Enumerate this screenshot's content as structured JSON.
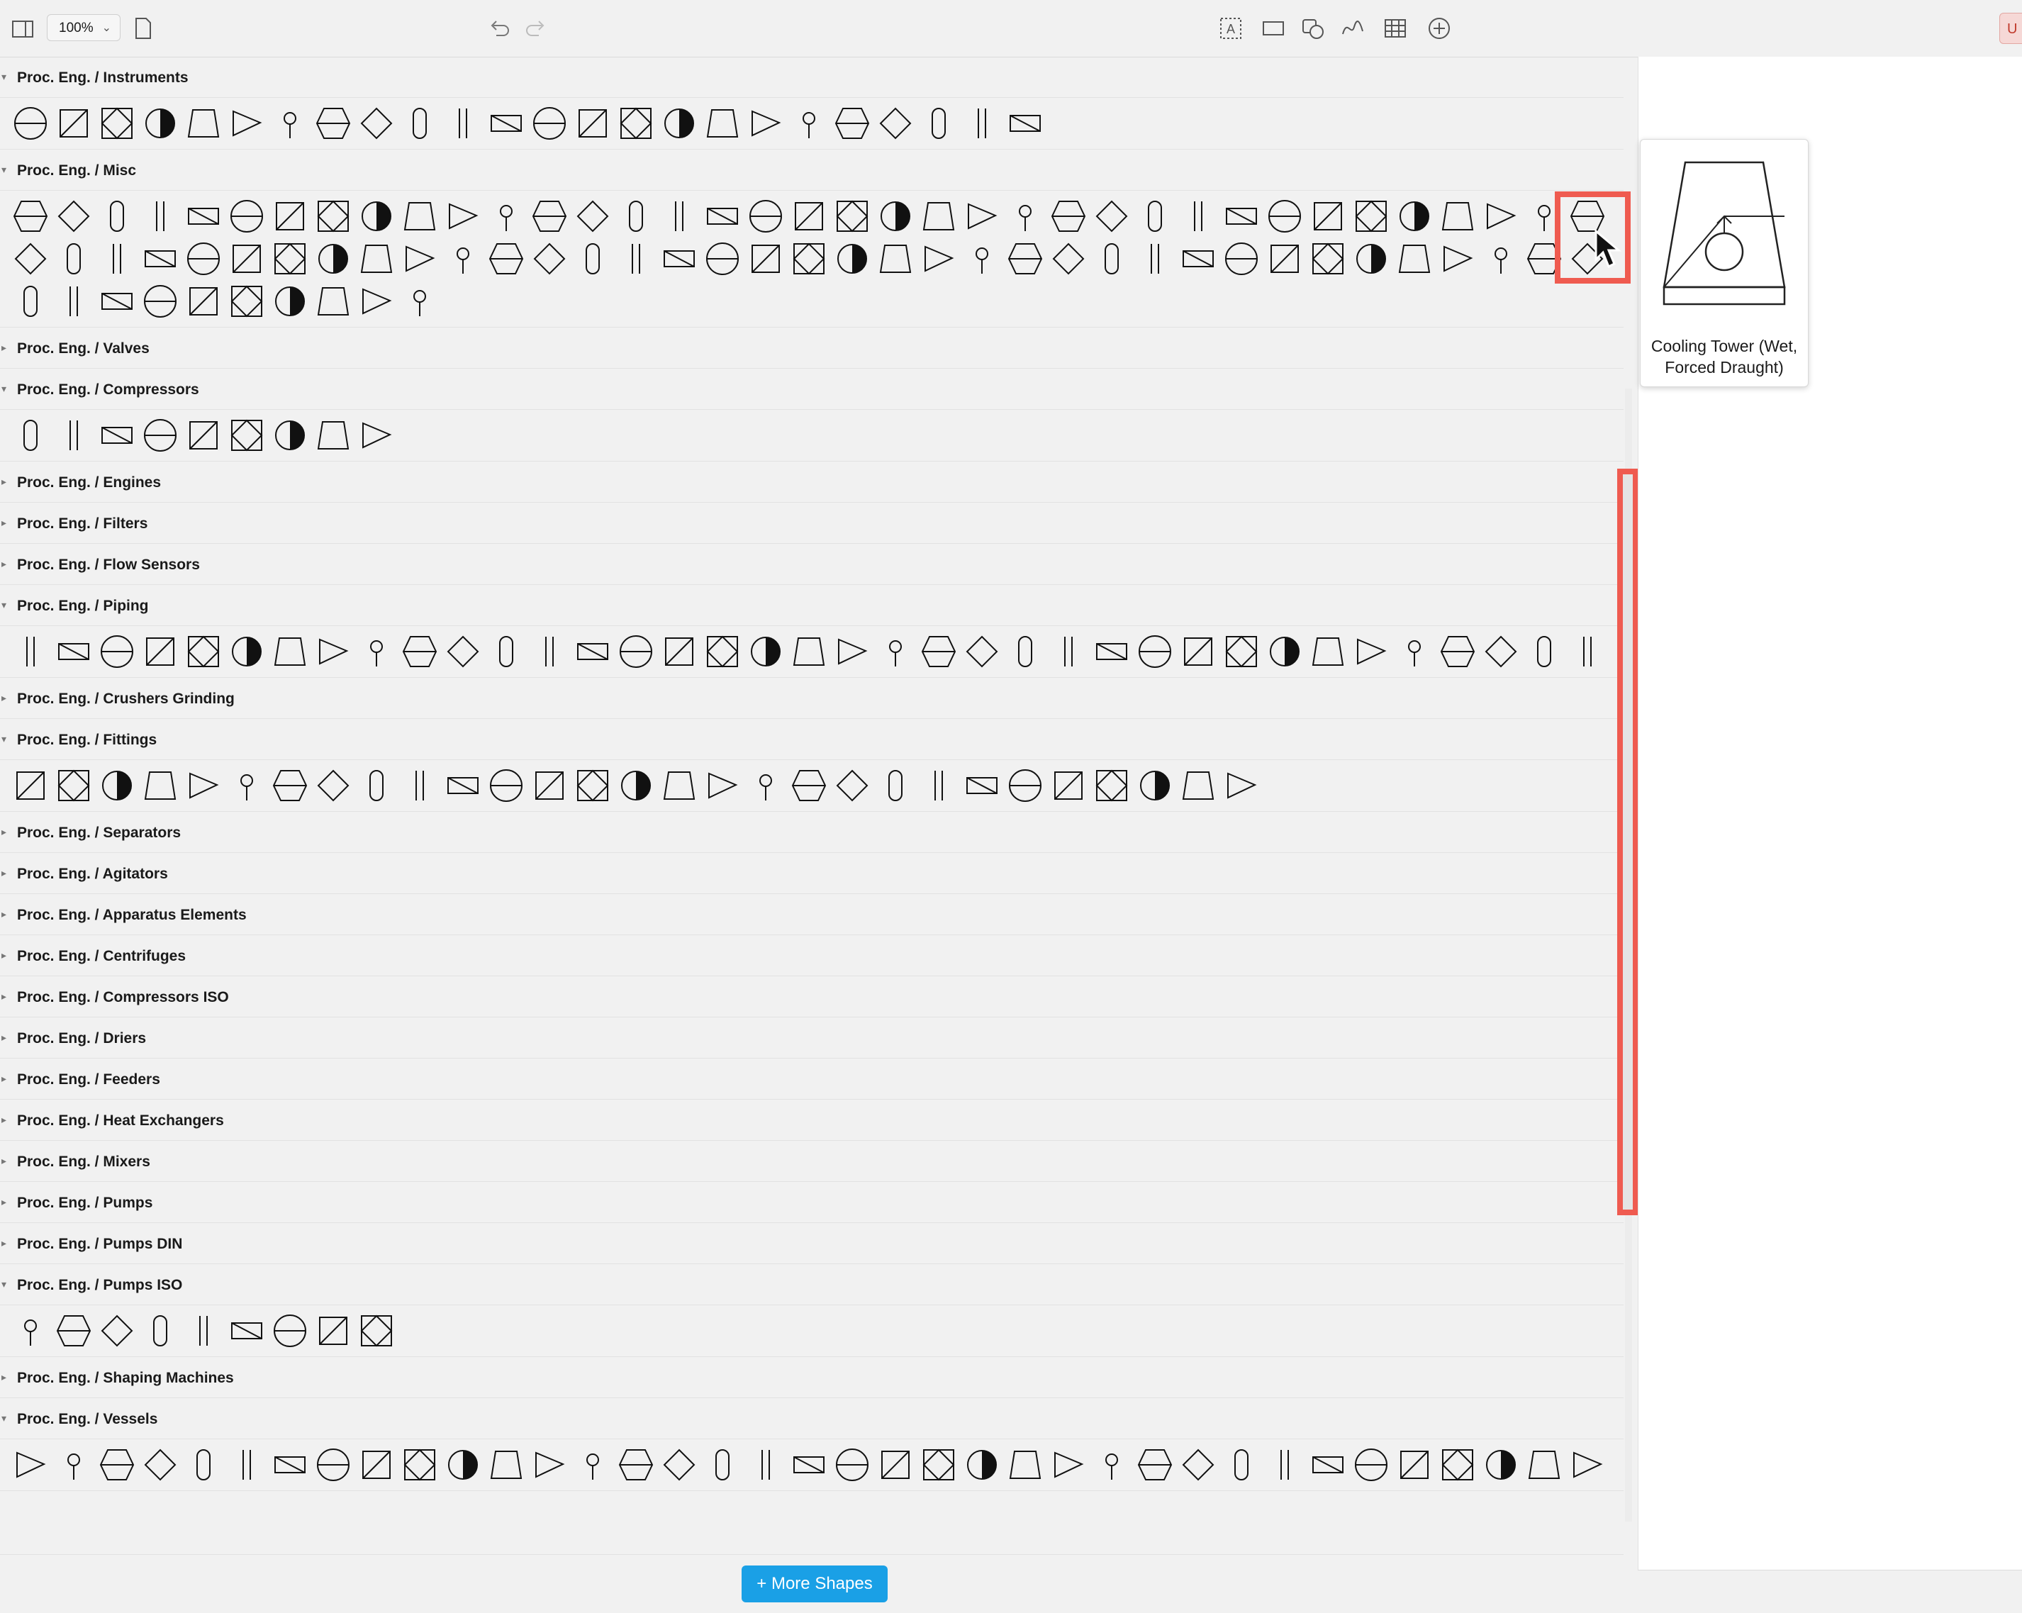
{
  "toolbar": {
    "zoom_value": "100%",
    "user_badge": "U"
  },
  "sections": [
    {
      "label": "Proc. Eng. / Instruments",
      "expanded": true,
      "rows": [
        24
      ]
    },
    {
      "label": "Proc. Eng. / Misc",
      "expanded": true,
      "rows": [
        37,
        37,
        10
      ]
    },
    {
      "label": "Proc. Eng. / Valves",
      "expanded": false,
      "rows": []
    },
    {
      "label": "Proc. Eng. / Compressors",
      "expanded": true,
      "rows": [
        9
      ]
    },
    {
      "label": "Proc. Eng. / Engines",
      "expanded": false,
      "rows": []
    },
    {
      "label": "Proc. Eng. / Filters",
      "expanded": false,
      "rows": []
    },
    {
      "label": "Proc. Eng. / Flow Sensors",
      "expanded": false,
      "rows": []
    },
    {
      "label": "Proc. Eng. / Piping",
      "expanded": true,
      "rows": [
        37
      ]
    },
    {
      "label": "Proc. Eng. / Crushers Grinding",
      "expanded": false,
      "rows": []
    },
    {
      "label": "Proc. Eng. / Fittings",
      "expanded": true,
      "rows": [
        29
      ]
    },
    {
      "label": "Proc. Eng. / Separators",
      "expanded": false,
      "rows": []
    },
    {
      "label": "Proc. Eng. / Agitators",
      "expanded": false,
      "rows": []
    },
    {
      "label": "Proc. Eng. / Apparatus Elements",
      "expanded": false,
      "rows": []
    },
    {
      "label": "Proc. Eng. / Centrifuges",
      "expanded": false,
      "rows": []
    },
    {
      "label": "Proc. Eng. / Compressors ISO",
      "expanded": false,
      "rows": []
    },
    {
      "label": "Proc. Eng. / Driers",
      "expanded": false,
      "rows": []
    },
    {
      "label": "Proc. Eng. / Feeders",
      "expanded": false,
      "rows": []
    },
    {
      "label": "Proc. Eng. / Heat Exchangers",
      "expanded": false,
      "rows": []
    },
    {
      "label": "Proc. Eng. / Mixers",
      "expanded": false,
      "rows": []
    },
    {
      "label": "Proc. Eng. / Pumps",
      "expanded": false,
      "rows": []
    },
    {
      "label": "Proc. Eng. / Pumps DIN",
      "expanded": false,
      "rows": []
    },
    {
      "label": "Proc. Eng. / Pumps ISO",
      "expanded": true,
      "rows": [
        9
      ]
    },
    {
      "label": "Proc. Eng. / Shaping Machines",
      "expanded": false,
      "rows": []
    },
    {
      "label": "Proc. Eng. / Vessels",
      "expanded": true,
      "rows": [
        37
      ]
    }
  ],
  "preview": {
    "label_line1": "Cooling Tower (Wet,",
    "label_line2": "Forced Draught)"
  },
  "more_shapes_label": "+ More Shapes",
  "colors": {
    "accent": "#1aa0e6",
    "highlight": "#ef5b50"
  }
}
